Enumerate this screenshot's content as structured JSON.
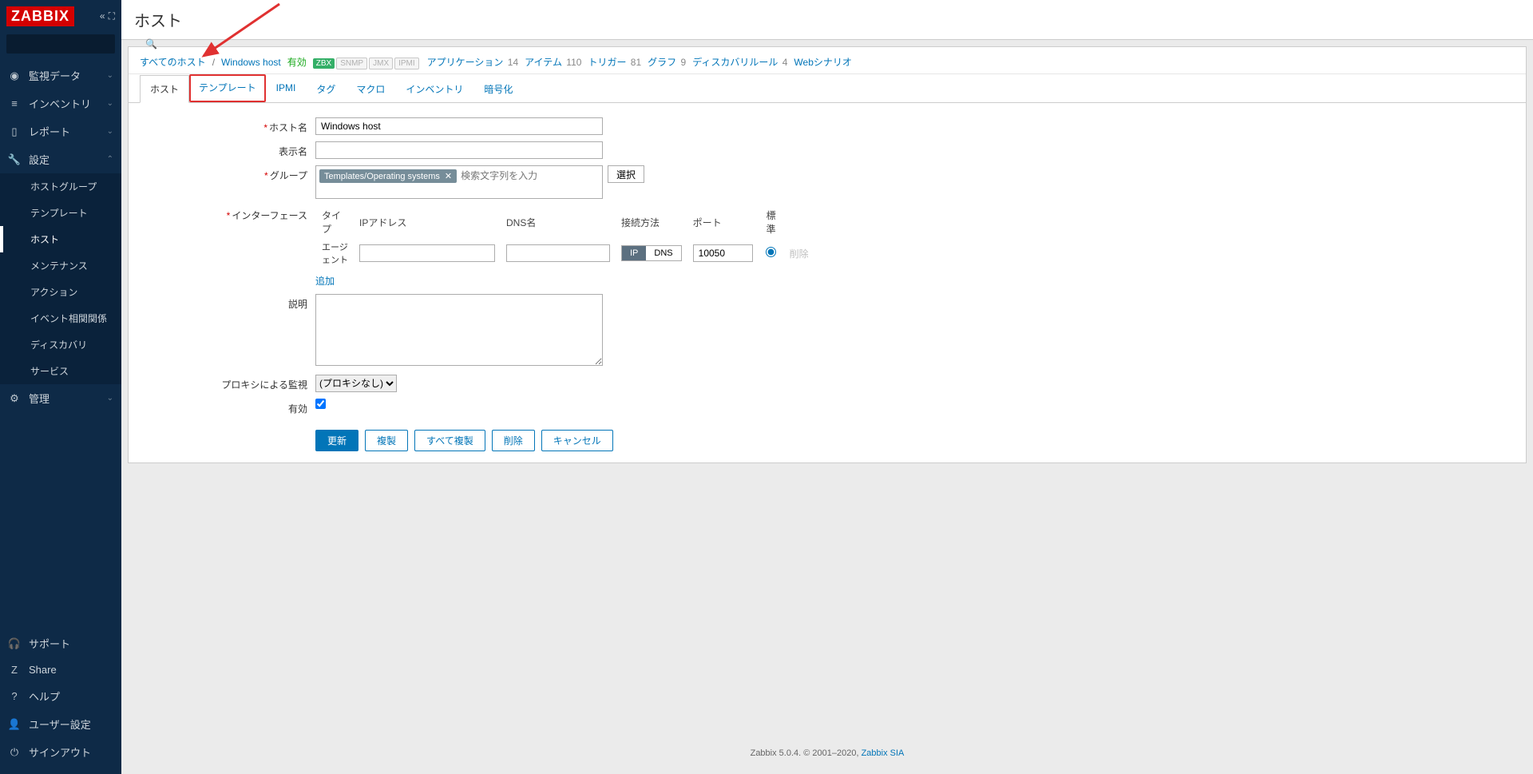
{
  "logo": "ZABBIX",
  "sidebar": {
    "nav": [
      {
        "icon": "◉",
        "label": "監視データ"
      },
      {
        "icon": "≡",
        "label": "インベントリ"
      },
      {
        "icon": "▯",
        "label": "レポート"
      },
      {
        "icon": "🔧",
        "label": "設定"
      },
      {
        "icon": "⚙",
        "label": "管理"
      }
    ],
    "sub_config": [
      "ホストグループ",
      "テンプレート",
      "ホスト",
      "メンテナンス",
      "アクション",
      "イベント相関関係",
      "ディスカバリ",
      "サービス"
    ],
    "footer": [
      {
        "icon": "🎧",
        "label": "サポート"
      },
      {
        "icon": "Z",
        "label": "Share"
      },
      {
        "icon": "?",
        "label": "ヘルプ"
      },
      {
        "icon": "👤",
        "label": "ユーザー設定"
      },
      {
        "icon": "⎋",
        "label": "サインアウト"
      }
    ]
  },
  "page": {
    "title": "ホスト",
    "breadcrumb": {
      "all_hosts": "すべてのホスト",
      "current": "Windows host"
    },
    "status": "有効",
    "tags": {
      "zbx": "ZBX",
      "snmp": "SNMP",
      "jmx": "JMX",
      "ipmi": "IPMI"
    },
    "links": [
      {
        "label": "アプリケーション",
        "count": "14"
      },
      {
        "label": "アイテム",
        "count": "110"
      },
      {
        "label": "トリガー",
        "count": "81"
      },
      {
        "label": "グラフ",
        "count": "9"
      },
      {
        "label": "ディスカバリルール",
        "count": "4"
      },
      {
        "label": "Webシナリオ",
        "count": ""
      }
    ],
    "tabs": [
      "ホスト",
      "テンプレート",
      "IPMI",
      "タグ",
      "マクロ",
      "インベントリ",
      "暗号化"
    ]
  },
  "form": {
    "labels": {
      "hostname": "ホスト名",
      "visible_name": "表示名",
      "groups": "グループ",
      "groups_placeholder": "検索文字列を入力",
      "interfaces": "インターフェース",
      "description": "説明",
      "proxy": "プロキシによる監視",
      "enabled": "有効"
    },
    "hostname": "Windows host",
    "visible_name": "",
    "group_chip": "Templates/Operating systems",
    "select_btn": "選択",
    "interface_headers": {
      "type": "タイプ",
      "ip": "IPアドレス",
      "dns": "DNS名",
      "conn": "接続方法",
      "port": "ポート",
      "default": "標準"
    },
    "interface_row": {
      "agent": "エージェント",
      "ip_btn": "IP",
      "dns_btn": "DNS",
      "port": "10050",
      "delete": "削除"
    },
    "add_link": "追加",
    "proxy_value": "(プロキシなし)",
    "buttons": {
      "update": "更新",
      "clone": "複製",
      "full_clone": "すべて複製",
      "delete": "削除",
      "cancel": "キャンセル"
    }
  },
  "footer": {
    "text": "Zabbix 5.0.4. © 2001–2020, ",
    "link": "Zabbix SIA"
  }
}
